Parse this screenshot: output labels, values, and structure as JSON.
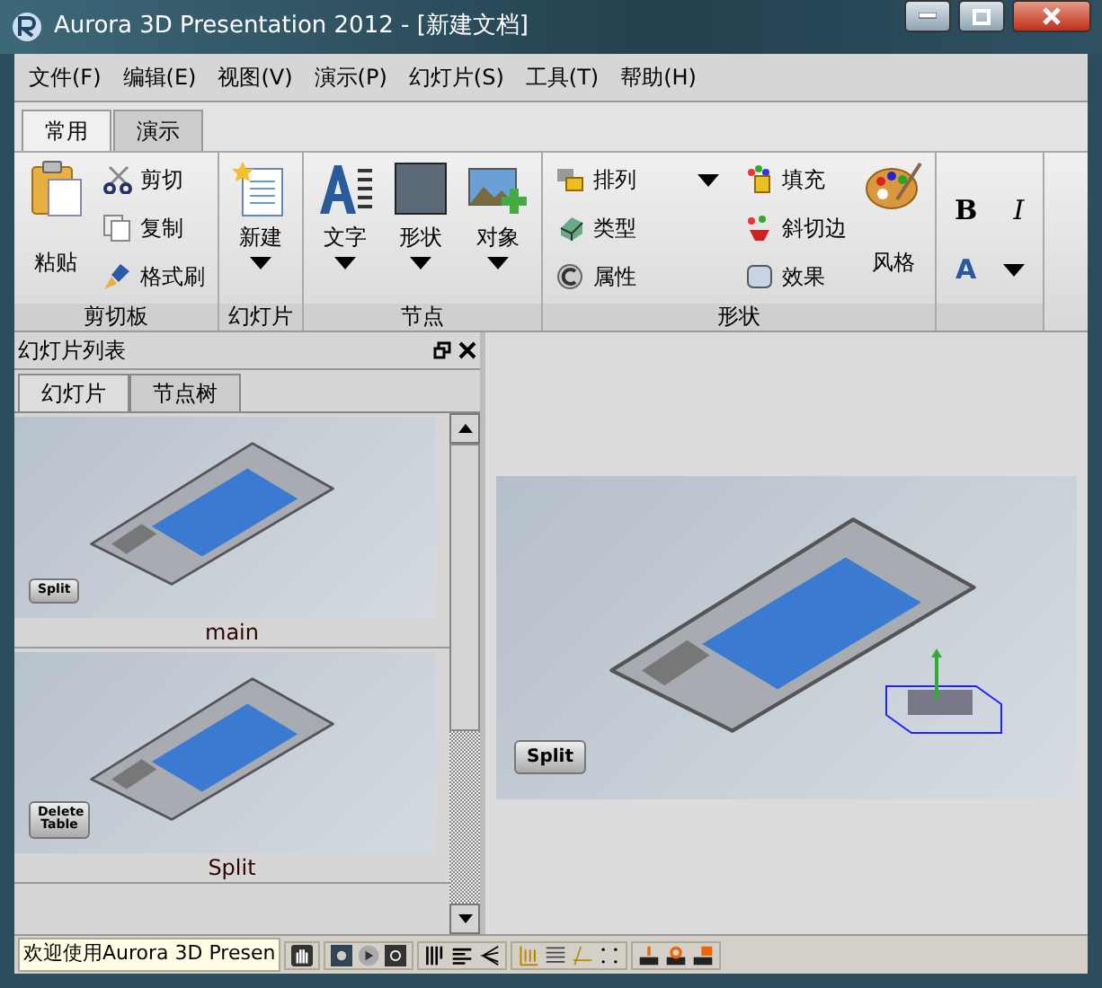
{
  "window": {
    "title": "Aurora 3D Presentation 2012 - [新建文档]"
  },
  "menu": [
    "文件(F)",
    "编辑(E)",
    "视图(V)",
    "演示(P)",
    "幻灯片(S)",
    "工具(T)",
    "帮助(H)"
  ],
  "ribbon_tabs": [
    {
      "label": "常用",
      "selected": true
    },
    {
      "label": "演示",
      "selected": false
    }
  ],
  "ribbon_groups": [
    {
      "label": "剪切板",
      "items": [
        {
          "kind": "large",
          "label": "粘贴",
          "dropdown": false
        },
        {
          "kind": "small",
          "label": "剪切"
        },
        {
          "kind": "small",
          "label": "复制"
        },
        {
          "kind": "small",
          "label": "格式刷"
        }
      ]
    },
    {
      "label": "幻灯片",
      "items": [
        {
          "kind": "large",
          "label": "新建",
          "dropdown": true
        }
      ]
    },
    {
      "label": "节点",
      "items": [
        {
          "kind": "large",
          "label": "文字",
          "dropdown": true
        },
        {
          "kind": "large",
          "label": "形状",
          "dropdown": true
        },
        {
          "kind": "large",
          "label": "对象",
          "dropdown": true
        }
      ]
    },
    {
      "label": "形状",
      "items": [
        {
          "kind": "small",
          "label": "排列",
          "dropdown": true
        },
        {
          "kind": "small",
          "label": "类型"
        },
        {
          "kind": "small",
          "label": "属性"
        },
        {
          "kind": "small",
          "label": "填充"
        },
        {
          "kind": "small",
          "label": "斜切边"
        },
        {
          "kind": "small",
          "label": "效果"
        },
        {
          "kind": "large",
          "label": "风格",
          "dropdown": false
        }
      ]
    },
    {
      "items": [
        {
          "kind": "glyph",
          "label": "B"
        },
        {
          "kind": "glyph",
          "label": "I"
        },
        {
          "kind": "glyph",
          "label": "A",
          "dropdown": true
        }
      ]
    }
  ],
  "slide_panel": {
    "title": "幻灯片列表",
    "tabs": [
      {
        "label": "幻灯片",
        "selected": true
      },
      {
        "label": "节点树",
        "selected": false
      }
    ],
    "slides": [
      {
        "caption": "main",
        "scene_button": "Split"
      },
      {
        "caption": "Split",
        "scene_button": "Delete Table"
      }
    ]
  },
  "viewport": {
    "scene_button": "Split"
  },
  "status_bar": {
    "text": "欢迎使用Aurora 3D Presen"
  }
}
